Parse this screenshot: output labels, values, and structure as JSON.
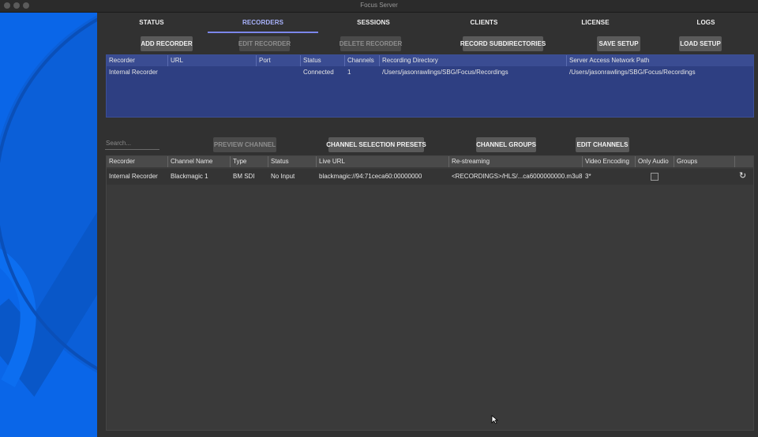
{
  "window": {
    "title": "Focus Server"
  },
  "tabs": [
    {
      "label": "STATUS"
    },
    {
      "label": "RECORDERS"
    },
    {
      "label": "SESSIONS"
    },
    {
      "label": "CLIENTS"
    },
    {
      "label": "LICENSE"
    },
    {
      "label": "LOGS"
    }
  ],
  "active_tab": "RECORDERS",
  "recorder_toolbar": {
    "add": "ADD RECORDER",
    "edit": "EDIT RECORDER",
    "delete": "DELETE RECORDER",
    "subdirs": "RECORD SUBDIRECTORIES",
    "save": "SAVE SETUP",
    "load": "LOAD SETUP"
  },
  "recorders_table": {
    "columns": [
      "Recorder",
      "URL",
      "Port",
      "Status",
      "Channels",
      "Recording Directory",
      "Server Access Network Path"
    ],
    "rows": [
      [
        "Internal Recorder",
        "",
        "",
        "Connected",
        "1",
        "/Users/jasonrawlings/SBG/Focus/Recordings",
        "/Users/jasonrawlings/SBG/Focus/Recordings"
      ]
    ]
  },
  "channel_toolbar": {
    "search_placeholder": "Search...",
    "preview": "PREVIEW CHANNEL",
    "presets": "CHANNEL SELECTION PRESETS",
    "groups": "CHANNEL GROUPS",
    "edit": "EDIT CHANNELS"
  },
  "channels_table": {
    "columns": [
      "Recorder",
      "Channel Name",
      "Type",
      "Status",
      "Live URL",
      "Re-streaming",
      "Video Encoding",
      "Only Audio",
      "Groups"
    ],
    "rows": [
      [
        "Internal Recorder",
        "Blackmagic 1",
        "BM SDI",
        "No Input",
        "blackmagic://94:71ceca60:00000000",
        "<RECORDINGS>/HLS/...ca6000000000.m3u8",
        "3*",
        "",
        ""
      ]
    ]
  },
  "icons": {
    "refresh": "refresh-icon",
    "only_audio": "checkbox-unchecked"
  },
  "colors": {
    "brand_blue": "#0a66e8",
    "recorder_table_bg": "#2e3f82",
    "active_tab": "#aab4ff"
  }
}
